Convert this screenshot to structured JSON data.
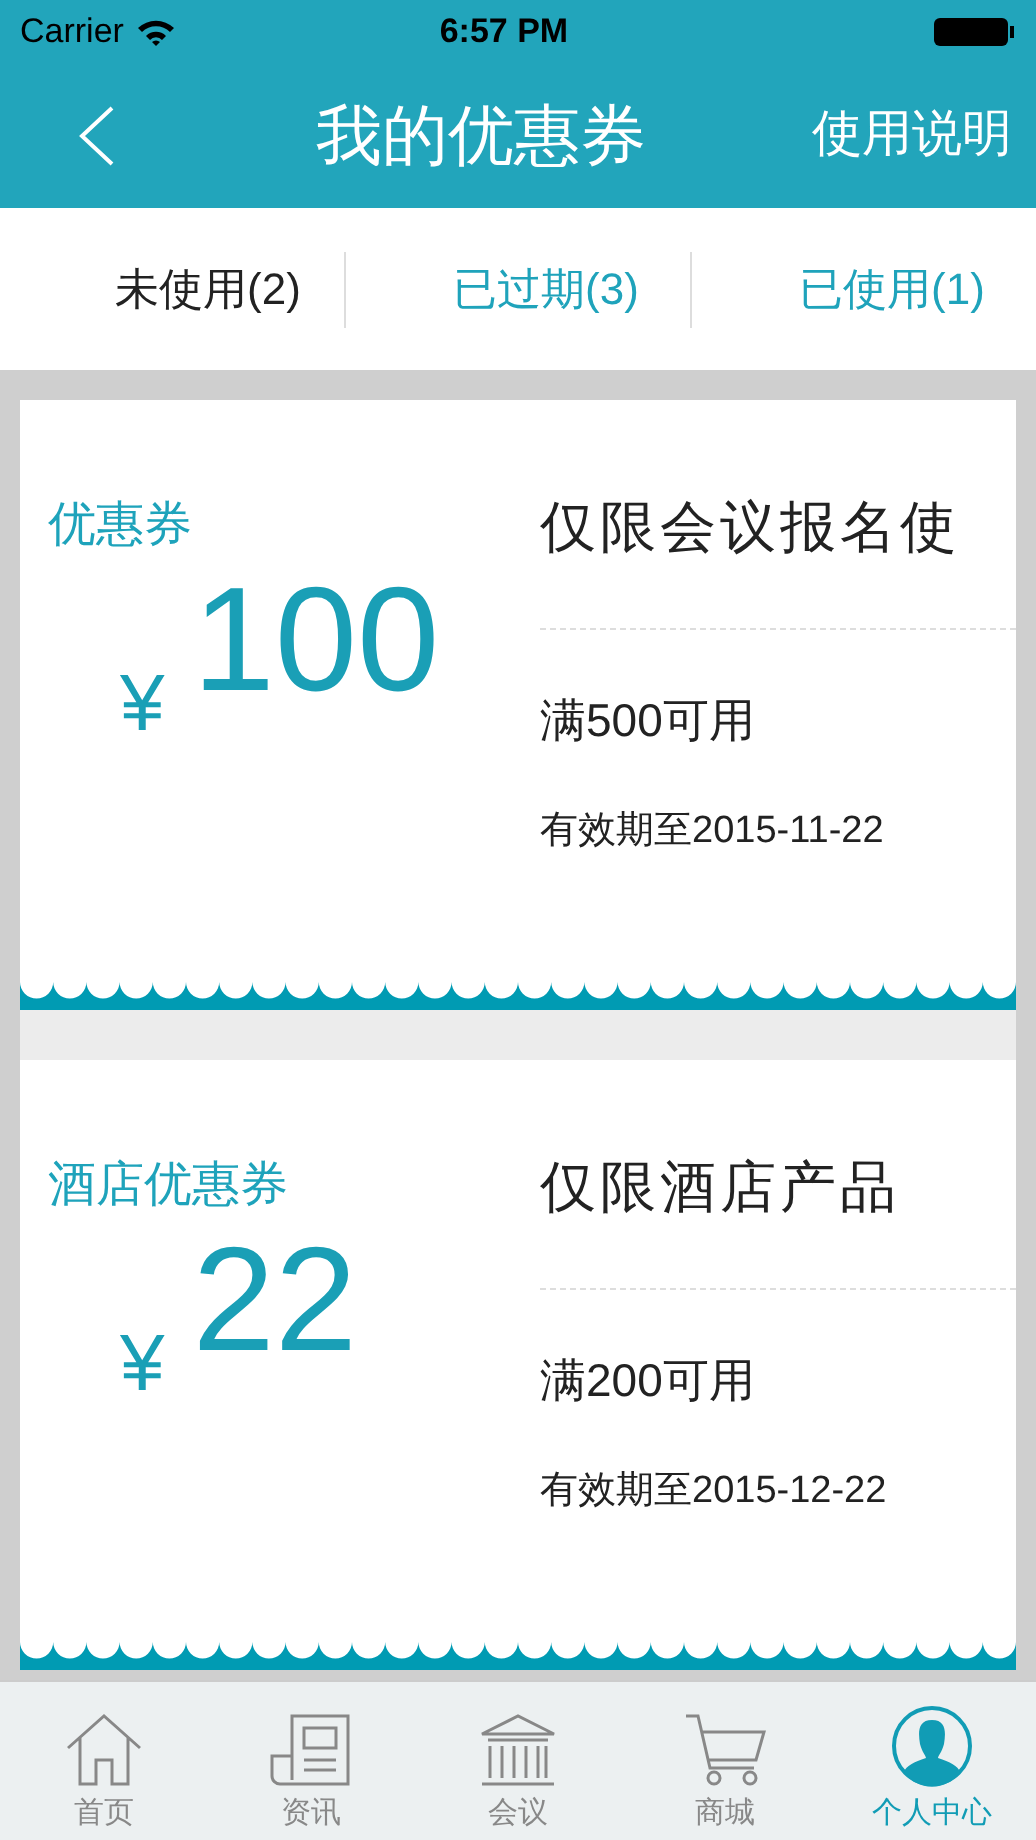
{
  "status_bar": {
    "carrier": "Carrier",
    "time": "6:57 PM"
  },
  "header": {
    "title": "我的优惠券",
    "action": "使用说明"
  },
  "tabs": [
    {
      "label": "未使用(2)",
      "selected": true
    },
    {
      "label": "已过期(3)",
      "selected": false
    },
    {
      "label": "已使用(1)",
      "selected": false
    }
  ],
  "coupons": [
    {
      "name": "优惠券",
      "currency": "¥",
      "amount": "100",
      "title": "仅限会议报名使",
      "condition": "满500可用",
      "validity": "有效期至2015-11-22"
    },
    {
      "name": "酒店优惠券",
      "currency": "¥",
      "amount": "22",
      "title": "仅限酒店产品",
      "condition": "满200可用",
      "validity": "有效期至2015-12-22"
    }
  ],
  "tab_bar": [
    {
      "kind": "home",
      "label": "首页",
      "selected": false
    },
    {
      "kind": "news",
      "label": "资讯",
      "selected": false
    },
    {
      "kind": "meeting",
      "label": "会议",
      "selected": false
    },
    {
      "kind": "cart",
      "label": "商城",
      "selected": false
    },
    {
      "kind": "person",
      "label": "个人中心",
      "selected": true
    }
  ]
}
